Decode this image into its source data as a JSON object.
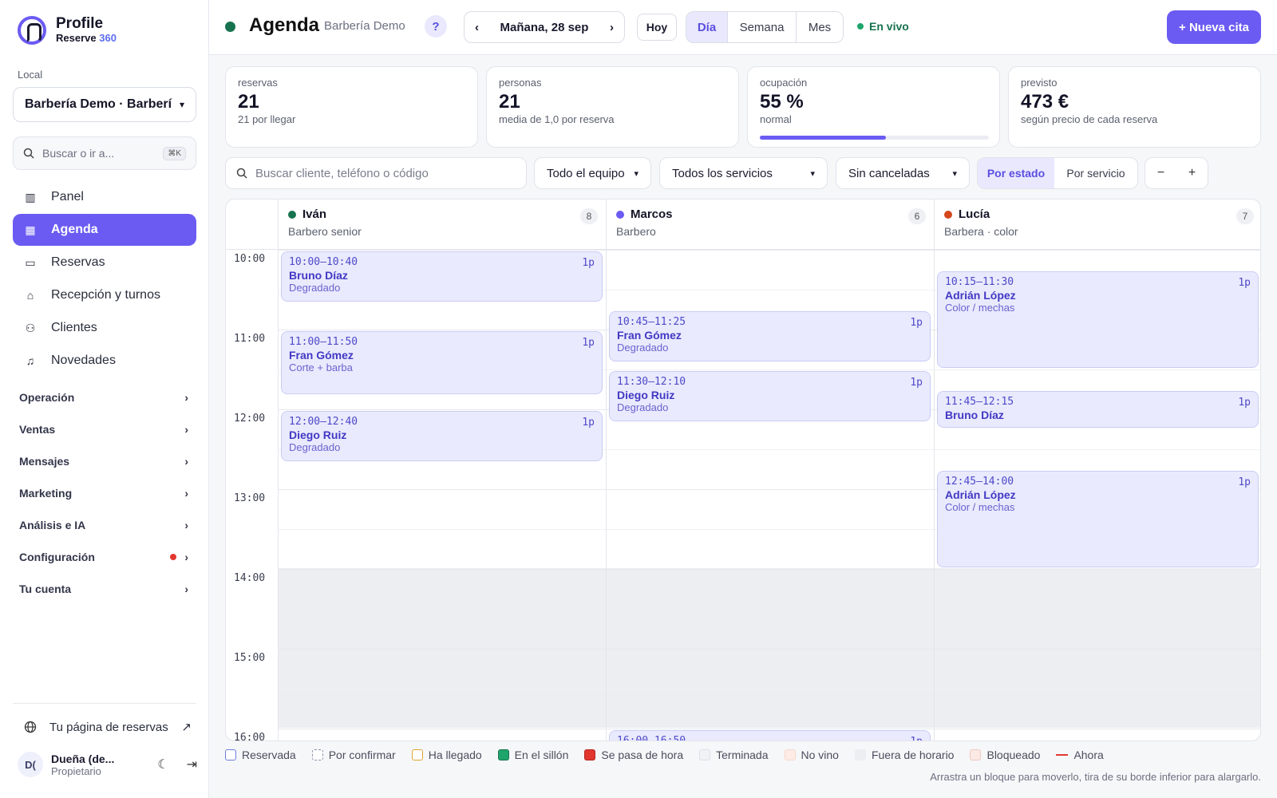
{
  "brand": {
    "name": "Profile",
    "sub_prefix": "Reserve",
    "sub_accent": "360"
  },
  "sidebar": {
    "local_label": "Local",
    "local_value": "Barbería Demo · Barberí",
    "search_placeholder": "Buscar o ir a...",
    "search_kbd": "⌘K",
    "items": [
      {
        "label": "Panel",
        "icon": "chart-icon"
      },
      {
        "label": "Agenda",
        "icon": "calendar-grid-icon",
        "active": true
      },
      {
        "label": "Reservas",
        "icon": "calendar-icon"
      },
      {
        "label": "Recepción y turnos",
        "icon": "bell-desk-icon"
      },
      {
        "label": "Clientes",
        "icon": "users-icon"
      },
      {
        "label": "Novedades",
        "icon": "bell-icon"
      }
    ],
    "groups": [
      {
        "label": "Operación"
      },
      {
        "label": "Ventas"
      },
      {
        "label": "Mensajes"
      },
      {
        "label": "Marketing"
      },
      {
        "label": "Análisis e IA"
      },
      {
        "label": "Configuración",
        "alert": true
      },
      {
        "label": "Tu cuenta"
      }
    ],
    "public_link": "Tu página de reservas",
    "user": {
      "initials": "D(",
      "name": "Dueña (de...",
      "role": "Propietario"
    }
  },
  "topbar": {
    "title": "Agenda",
    "subtitle": "Barbería Demo",
    "help": "?",
    "date_label": "Mañana, 28 sep",
    "prev": "‹",
    "next": "›",
    "today": "Hoy",
    "views": [
      "Día",
      "Semana",
      "Mes"
    ],
    "active_view": "Día",
    "live": "En vivo",
    "new_button": "+ Nueva cita"
  },
  "stats": [
    {
      "label": "reservas",
      "value": "21",
      "sub": "21 por llegar"
    },
    {
      "label": "personas",
      "value": "21",
      "sub": "media de 1,0 por reserva"
    },
    {
      "label": "ocupación",
      "value": "55 %",
      "sub": "normal",
      "progress": 0.55
    },
    {
      "label": "previsto",
      "value": "473 €",
      "sub": "según precio de cada reserva"
    }
  ],
  "filters": {
    "search_placeholder": "Buscar cliente, teléfono o código",
    "team": "Todo el equipo",
    "services": "Todos los servicios",
    "cancel": "Sin canceladas",
    "color_mode": [
      "Por estado",
      "Por servicio"
    ],
    "zoom_out": "−",
    "zoom_in": "+"
  },
  "calendar": {
    "hours": [
      "10:00",
      "11:00",
      "12:00",
      "13:00",
      "14:00",
      "15:00",
      "16:00"
    ],
    "staff": [
      {
        "name": "Iván",
        "role": "Barbero senior",
        "count": "8",
        "color": "#17734f"
      },
      {
        "name": "Marcos",
        "role": "Barbero",
        "count": "6",
        "color": "#6b5bf2"
      },
      {
        "name": "Lucía",
        "role": "Barbera · color",
        "count": "7",
        "color": "#d4481c"
      }
    ],
    "events": [
      {
        "staff": 0,
        "time": "10:00–10:40",
        "pax": "1p",
        "client": "Bruno Díaz",
        "service": "Degradado"
      },
      {
        "staff": 0,
        "time": "11:00–11:50",
        "pax": "1p",
        "client": "Fran Gómez",
        "service": "Corte + barba"
      },
      {
        "staff": 0,
        "time": "12:00–12:40",
        "pax": "1p",
        "client": "Diego Ruiz",
        "service": "Degradado"
      },
      {
        "staff": 1,
        "time": "10:45–11:25",
        "pax": "1p",
        "client": "Fran Gómez",
        "service": "Degradado"
      },
      {
        "staff": 1,
        "time": "11:30–12:10",
        "pax": "1p",
        "client": "Diego Ruiz",
        "service": "Degradado"
      },
      {
        "staff": 1,
        "time": "16:00–16:50",
        "pax": "1p",
        "client": "",
        "service": ""
      },
      {
        "staff": 2,
        "time": "10:15–11:30",
        "pax": "1p",
        "client": "Adrián López",
        "service": "Color / mechas"
      },
      {
        "staff": 2,
        "time": "11:45–12:15",
        "pax": "1p",
        "client": "Bruno Díaz",
        "service": ""
      },
      {
        "staff": 2,
        "time": "12:45–14:00",
        "pax": "1p",
        "client": "Adrián López",
        "service": "Color / mechas"
      }
    ]
  },
  "legend": [
    {
      "label": "Reservada",
      "border": "#6b7ee0",
      "fill": "#ffffff",
      "style": "solid"
    },
    {
      "label": "Por confirmar",
      "border": "#8a8fa8",
      "fill": "#ffffff",
      "style": "dashed"
    },
    {
      "label": "Ha llegado",
      "border": "#e0a531",
      "fill": "#ffffff",
      "style": "solid"
    },
    {
      "label": "En el sillón",
      "border": "#17734f",
      "fill": "#1fa56b",
      "style": "solid"
    },
    {
      "label": "Se pasa de hora",
      "border": "#b32620",
      "fill": "#e2372f",
      "style": "solid"
    },
    {
      "label": "Terminada",
      "border": "#dcdfe6",
      "fill": "#f1f2f5",
      "style": "solid"
    },
    {
      "label": "No vino",
      "border": "#f6d8cc",
      "fill": "#fdece5",
      "style": "solid"
    },
    {
      "label": "Fuera de horario",
      "border": "#eceef1",
      "fill": "#eceef1",
      "style": "solid"
    },
    {
      "label": "Bloqueado",
      "border": "#f0c9c0",
      "fill": "#fbe9e4",
      "style": "solid"
    },
    {
      "label": "Ahora",
      "line": true
    }
  ],
  "hint": "Arrastra un bloque para moverlo, tira de su borde inferior para alargarlo."
}
